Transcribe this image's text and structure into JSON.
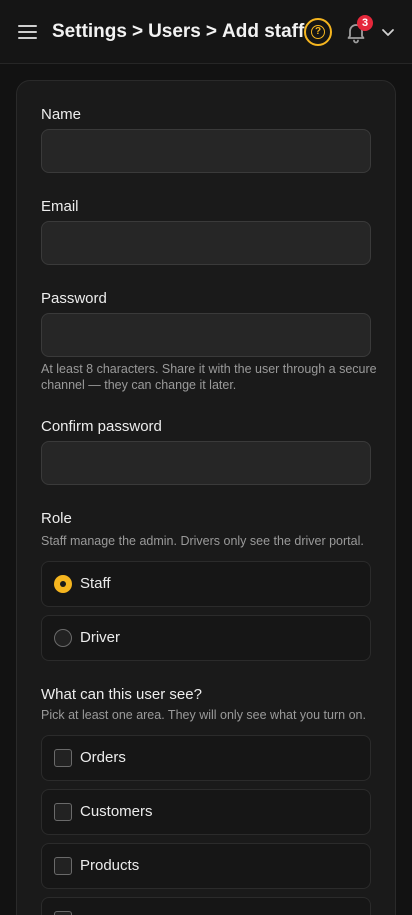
{
  "header": {
    "breadcrumb": [
      "Settings",
      "Users",
      "Add staff"
    ],
    "separator": ">",
    "notification_count": "3",
    "accent_color": "#f5b51f",
    "badge_color": "#e5283b"
  },
  "form": {
    "name": {
      "label": "Name",
      "value": ""
    },
    "email": {
      "label": "Email",
      "value": ""
    },
    "password": {
      "label": "Password",
      "value": "",
      "hint": "At least 8 characters. Share it with the user through a secure channel — they can change it later."
    },
    "confirm_password": {
      "label": "Confirm password",
      "value": ""
    },
    "role": {
      "label": "Role",
      "hint": "Staff manage the admin. Drivers only see the driver portal.",
      "options": [
        {
          "label": "Staff",
          "selected": true
        },
        {
          "label": "Driver",
          "selected": false
        }
      ]
    },
    "permissions": {
      "label": "What can this user see?",
      "hint": "Pick at least one area. They will only see what you turn on.",
      "options": [
        {
          "label": "Orders",
          "checked": false
        },
        {
          "label": "Customers",
          "checked": false
        },
        {
          "label": "Products",
          "checked": false
        }
      ]
    }
  },
  "icons": {
    "menu": "hamburger-icon",
    "help": "help-circle-icon",
    "bell": "bell-icon",
    "chevron": "chevron-down-icon"
  }
}
